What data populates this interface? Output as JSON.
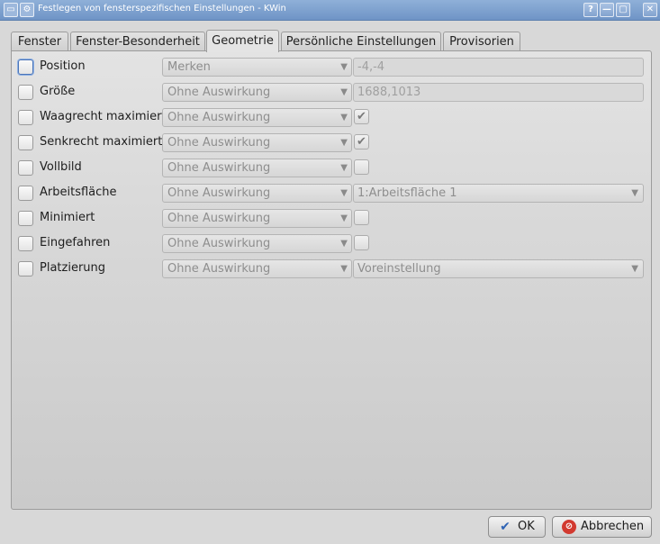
{
  "window": {
    "title": "Festlegen von fensterspezifischen Einstellungen - KWin",
    "buttons": {
      "help": "?",
      "minimize": "—",
      "maximize": "▢",
      "close": "✕"
    }
  },
  "tabs": [
    {
      "label": "Fenster",
      "active": false
    },
    {
      "label": "Fenster-Besonderheit",
      "active": false
    },
    {
      "label": "Geometrie",
      "active": true
    },
    {
      "label": "Persönliche Einstellungen",
      "active": false
    },
    {
      "label": "Provisorien",
      "active": false
    }
  ],
  "rows": [
    {
      "label": "Position",
      "rule": "Merken",
      "value": "-4,-4",
      "value_type": "text",
      "checked": false,
      "focused": true
    },
    {
      "label": "Größe",
      "rule": "Ohne Auswirkung",
      "value": "1688,1013",
      "value_type": "text",
      "checked": false
    },
    {
      "label": "Waagrecht maximiert",
      "rule": "Ohne Auswirkung",
      "value_type": "check",
      "value_checked": true,
      "checked": false
    },
    {
      "label": "Senkrecht maximiert",
      "rule": "Ohne Auswirkung",
      "value_type": "check",
      "value_checked": true,
      "checked": false
    },
    {
      "label": "Vollbild",
      "rule": "Ohne Auswirkung",
      "value_type": "check",
      "value_checked": false,
      "checked": false
    },
    {
      "label": "Arbeitsfläche",
      "rule": "Ohne Auswirkung",
      "value": "1:Arbeitsfläche 1",
      "value_type": "combo",
      "checked": false
    },
    {
      "label": "Minimiert",
      "rule": "Ohne Auswirkung",
      "value_type": "check",
      "value_checked": false,
      "checked": false
    },
    {
      "label": "Eingefahren",
      "rule": "Ohne Auswirkung",
      "value_type": "check",
      "value_checked": false,
      "checked": false
    },
    {
      "label": "Platzierung",
      "rule": "Ohne Auswirkung",
      "value": "Voreinstellung",
      "value_type": "combo",
      "checked": false
    }
  ],
  "footer": {
    "ok_label": "OK",
    "cancel_label": "Abbrechen"
  },
  "icons": {
    "dropdown": "chevron-down-icon",
    "ok": "checkmark-icon",
    "cancel": "cancel-icon"
  },
  "colors": {
    "titlebar": "#7a9dcc",
    "focus": "#4a74b8",
    "cancel_icon": "#d23a30"
  }
}
